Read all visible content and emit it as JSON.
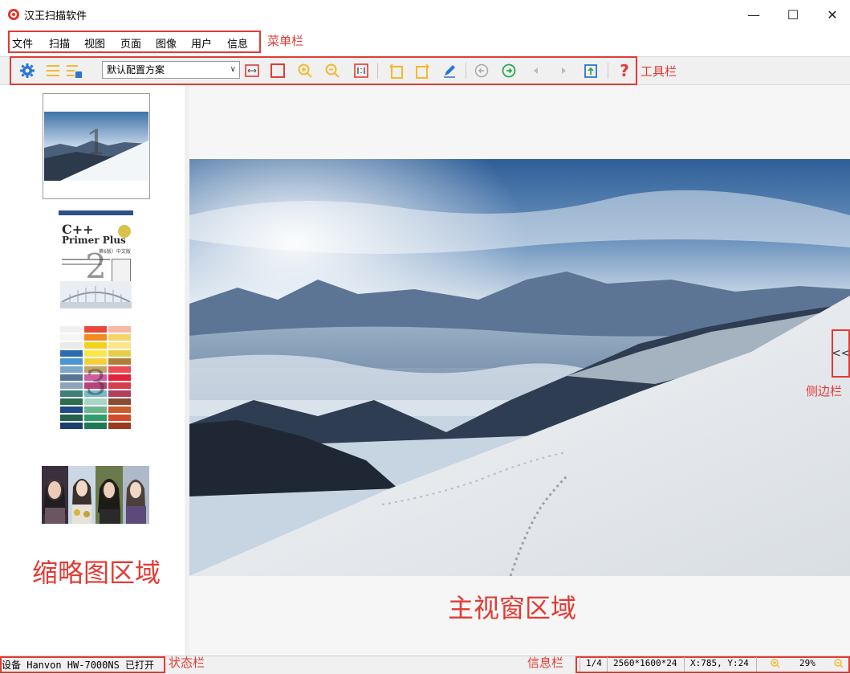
{
  "window": {
    "title": "汉王扫描软件",
    "minimize": "—",
    "maximize": "☐",
    "close": "✕"
  },
  "menubar": {
    "items": [
      "文件",
      "扫描",
      "视图",
      "页面",
      "图像",
      "用户",
      "信息"
    ],
    "annotation": "菜单栏"
  },
  "toolbar": {
    "scheme_value": "默认配置方案",
    "annotation": "工具栏",
    "icons": [
      "gear-icon",
      "scan-icon",
      "scan-settings-icon",
      "fit-width-icon",
      "fit-page-icon",
      "zoom-in-icon",
      "zoom-out-icon",
      "actual-size-icon",
      "rotate-left-icon",
      "rotate-right-icon",
      "edit-pen-icon",
      "prev-page-icon",
      "next-page-icon",
      "back-arrow-icon",
      "forward-arrow-icon",
      "export-icon",
      "help-icon"
    ],
    "accent": "#f5b82e",
    "blue": "#2a77d0",
    "green": "#2aab53",
    "red": "#e23b34"
  },
  "thumbnails": {
    "items": [
      {
        "number": "1",
        "kind": "snow-landscape"
      },
      {
        "number": "2",
        "kind": "book-cover",
        "title_line1": "C++",
        "title_line2": "Primer Plus",
        "edition": "第6版）中文版"
      },
      {
        "number": "3",
        "kind": "color-chart"
      },
      {
        "number": "",
        "kind": "portrait-collage"
      }
    ],
    "annotation": "缩略图区域"
  },
  "main": {
    "annotation": "主视窗区域",
    "sidebar_toggle": "<<",
    "sidebar_annotation": "侧边栏"
  },
  "statusbar": {
    "text": "设备 Hanvon HW-7000NS 已打开",
    "annotation": "状态栏"
  },
  "infobar": {
    "annotation": "信息栏",
    "page": "1/4",
    "size": "2560*1600*24",
    "coords": "X:785, Y:24",
    "zoom": "29%"
  }
}
